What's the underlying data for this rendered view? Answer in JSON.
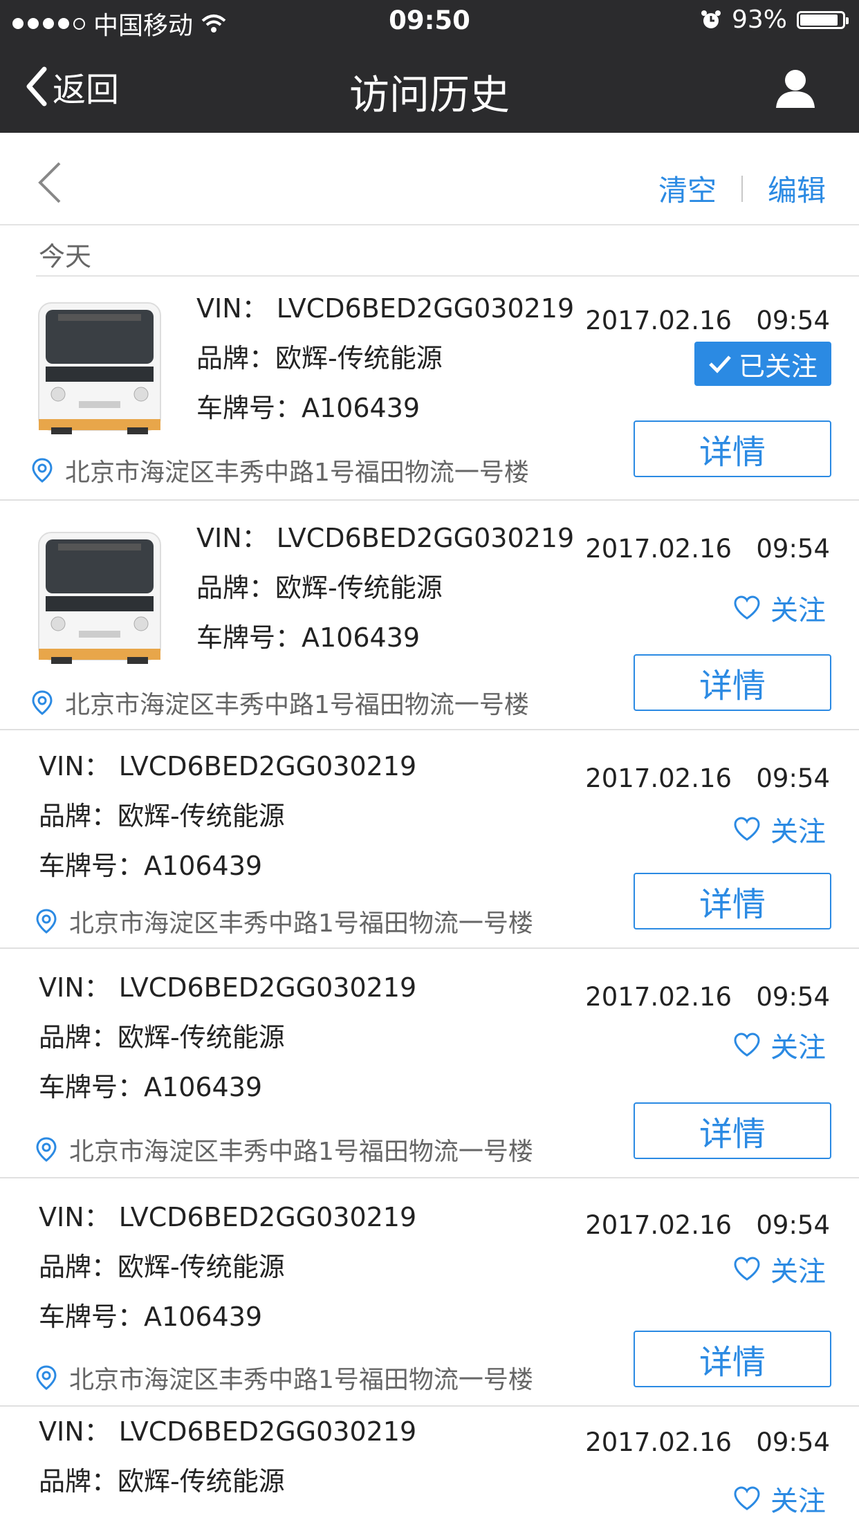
{
  "status_bar": {
    "carrier": "中国移动",
    "time": "09:50",
    "battery": "93%",
    "battery_level": 0.93
  },
  "nav": {
    "back_label": "返回",
    "title": "访问历史",
    "user_icon": "user-icon"
  },
  "toolbar": {
    "clear_label": "清空",
    "edit_label": "编辑"
  },
  "section": {
    "label": "今天"
  },
  "labels": {
    "vin": "VIN：",
    "brand": "品牌：",
    "plate": "车牌号：",
    "follow": "关注",
    "followed": "已关注",
    "detail": "详情"
  },
  "items": [
    {
      "vin": "LVCD6BED2GG030219",
      "brand": "欧辉-传统能源",
      "plate": "A106439",
      "address": "北京市海淀区丰秀中路1号福田物流一号楼",
      "date": "2017.02.16",
      "time": "09:54",
      "followed": true,
      "has_image": true
    },
    {
      "vin": "LVCD6BED2GG030219",
      "brand": "欧辉-传统能源",
      "plate": "A106439",
      "address": "北京市海淀区丰秀中路1号福田物流一号楼",
      "date": "2017.02.16",
      "time": "09:54",
      "followed": false,
      "has_image": true
    },
    {
      "vin": "LVCD6BED2GG030219",
      "brand": "欧辉-传统能源",
      "plate": "A106439",
      "address": "北京市海淀区丰秀中路1号福田物流一号楼",
      "date": "2017.02.16",
      "time": "09:54",
      "followed": false,
      "has_image": false
    },
    {
      "vin": "LVCD6BED2GG030219",
      "brand": "欧辉-传统能源",
      "plate": "A106439",
      "address": "北京市海淀区丰秀中路1号福田物流一号楼",
      "date": "2017.02.16",
      "time": "09:54",
      "followed": false,
      "has_image": false
    },
    {
      "vin": "LVCD6BED2GG030219",
      "brand": "欧辉-传统能源",
      "plate": "A106439",
      "address": "北京市海淀区丰秀中路1号福田物流一号楼",
      "date": "2017.02.16",
      "time": "09:54",
      "followed": false,
      "has_image": false
    },
    {
      "vin": "LVCD6BED2GG030219",
      "brand": "欧辉-传统能源",
      "plate": "",
      "address": "",
      "date": "2017.02.16",
      "time": "09:54",
      "followed": false,
      "has_image": false
    }
  ],
  "colors": {
    "accent": "#2b8ae3",
    "header_bg": "#2b2b2d"
  }
}
